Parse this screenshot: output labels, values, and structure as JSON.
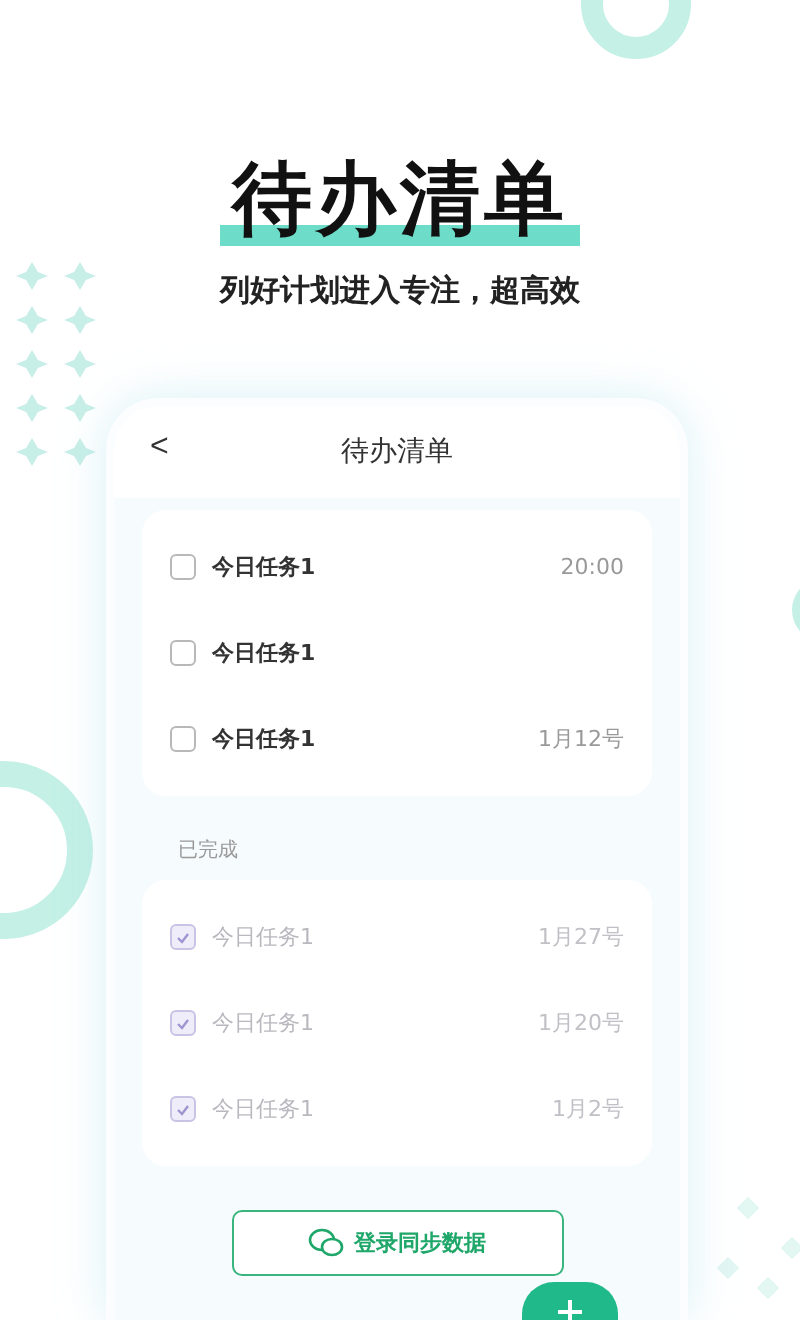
{
  "headline": "待办清单",
  "subtitle": "列好计划进入专注，超高效",
  "phone": {
    "back": "<",
    "title": "待办清单",
    "todo": [
      {
        "title": "今日任务1",
        "due": "20:00",
        "checked": false
      },
      {
        "title": "今日任务1",
        "checked": false
      },
      {
        "title": "今日任务1",
        "due": "1月12号",
        "checked": false
      }
    ],
    "done_label": "已完成",
    "done": [
      {
        "title": "今日任务1",
        "due": "1月27号",
        "checked": true
      },
      {
        "title": "今日任务1",
        "due": "1月20号",
        "checked": true
      },
      {
        "title": "今日任务1",
        "due": "1月2号",
        "checked": true
      }
    ],
    "sync_button": "登录同步数据"
  }
}
